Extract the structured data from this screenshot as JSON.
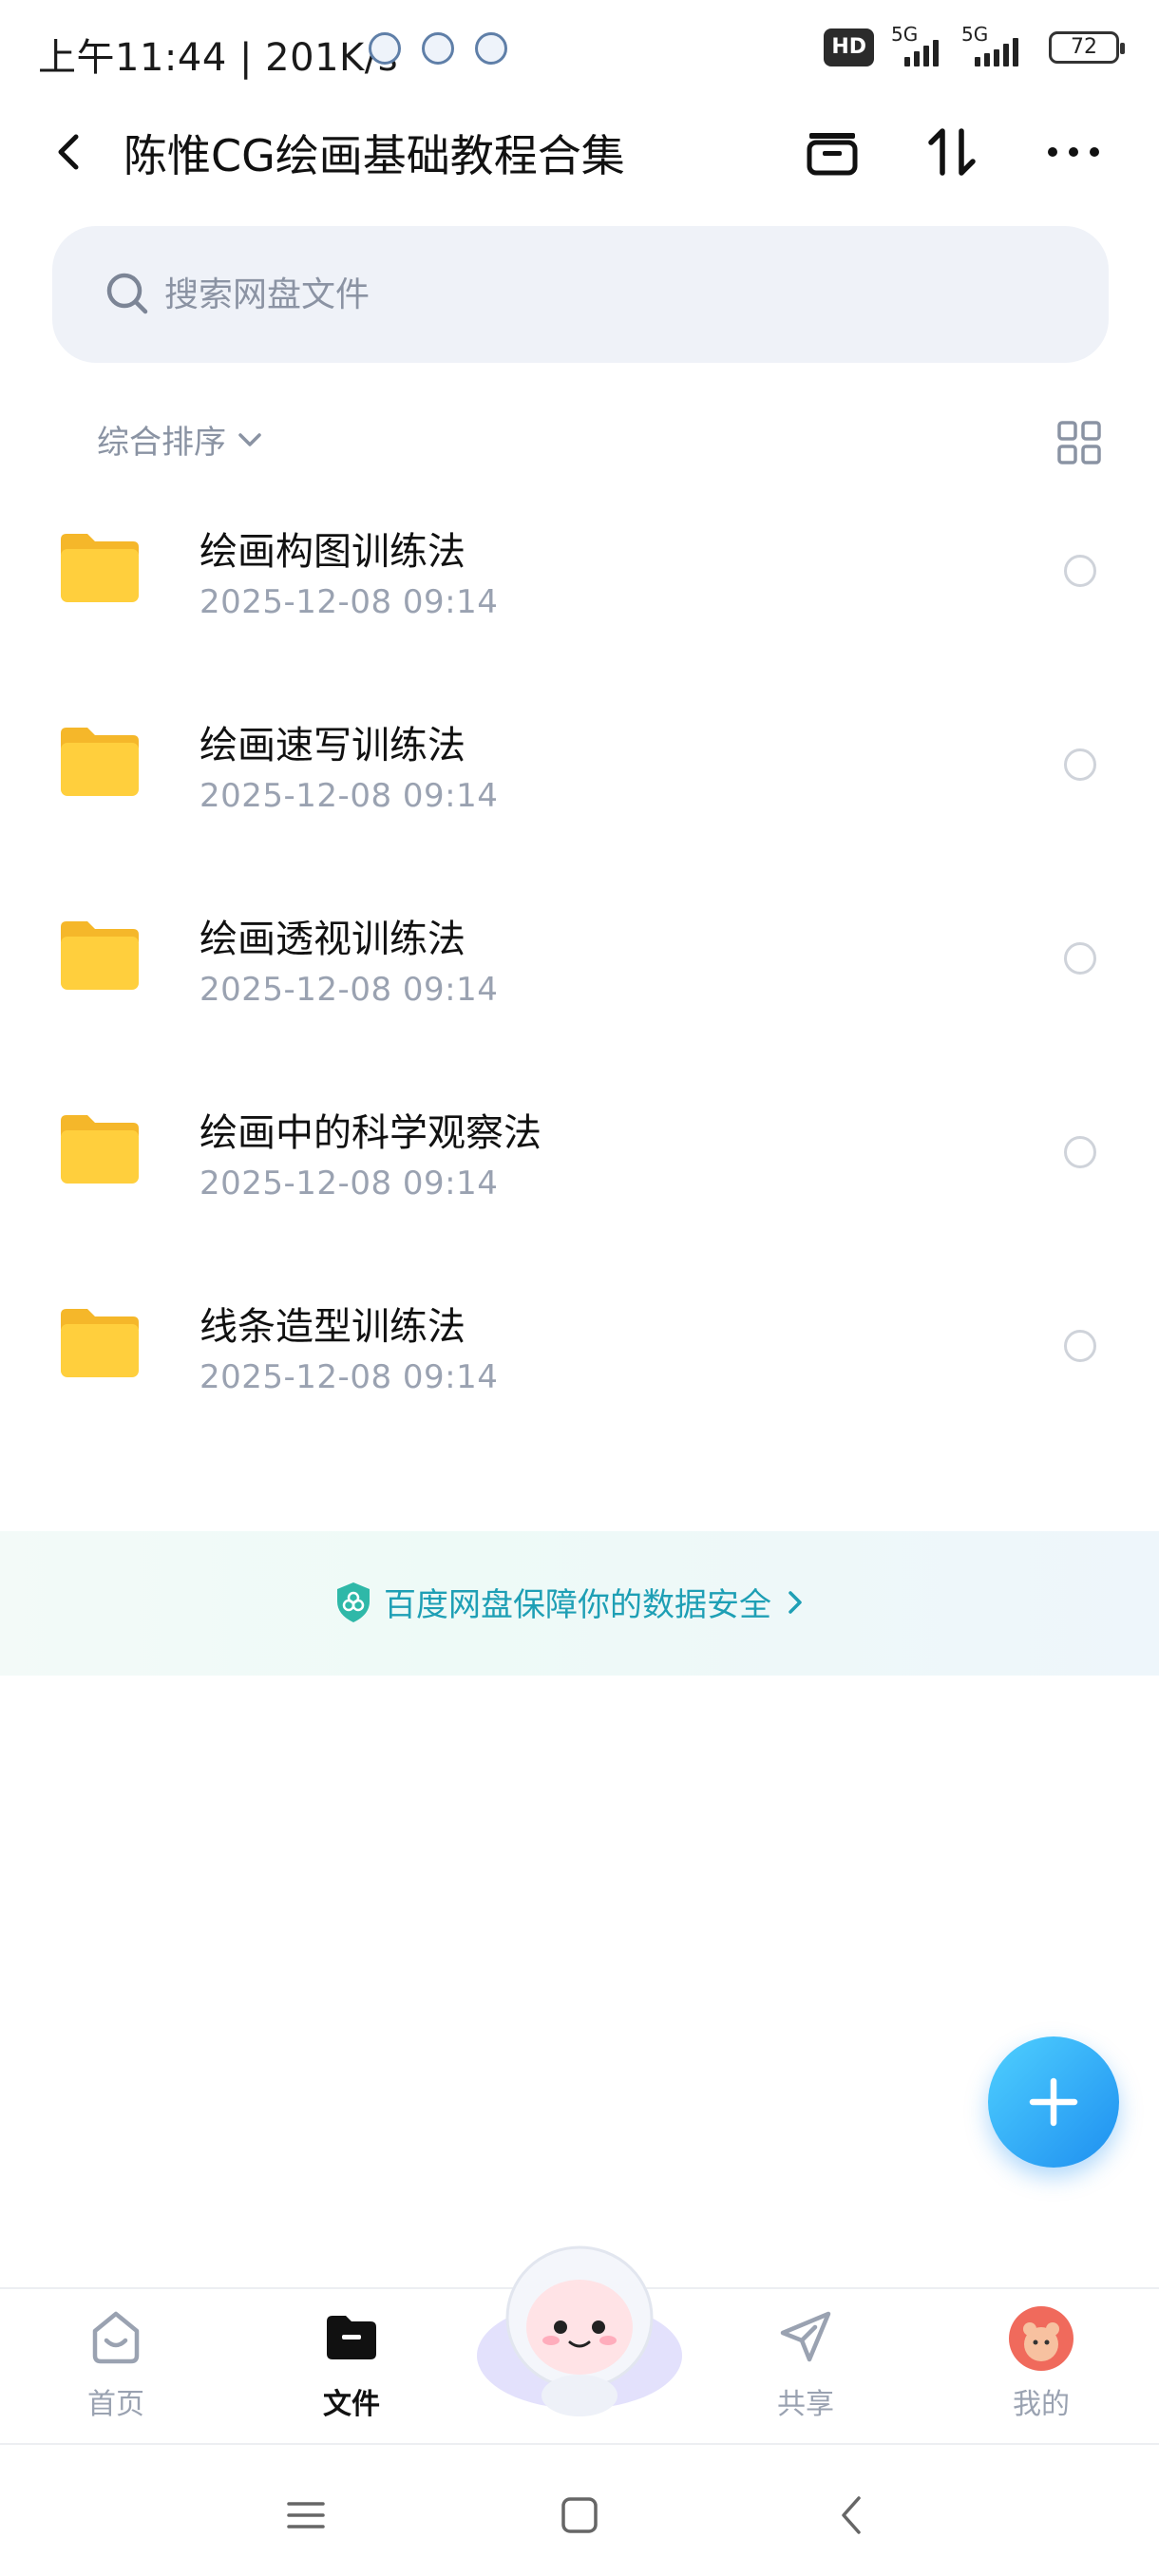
{
  "status_bar": {
    "time": "上午11:44 | 201K/s",
    "network_label_1": "5G",
    "network_label_2": "5G",
    "hd_label": "HD",
    "battery": "72"
  },
  "header": {
    "title": "陈惟CG绘画基础教程合集"
  },
  "search": {
    "placeholder": "搜索网盘文件"
  },
  "sort": {
    "label": "综合排序"
  },
  "files": [
    {
      "name": "绘画构图训练法",
      "date": "2025-12-08  09:14"
    },
    {
      "name": "绘画速写训练法",
      "date": "2025-12-08  09:14"
    },
    {
      "name": "绘画透视训练法",
      "date": "2025-12-08  09:14"
    },
    {
      "name": "绘画中的科学观察法",
      "date": "2025-12-08  09:14"
    },
    {
      "name": "线条造型训练法",
      "date": "2025-12-08  09:14"
    }
  ],
  "banner": {
    "text": "百度网盘保障你的数据安全"
  },
  "bottom_nav": [
    {
      "label": "首页",
      "icon": "home-icon"
    },
    {
      "label": "文件",
      "icon": "folder-icon"
    },
    {
      "label": "共享",
      "icon": "share-icon"
    },
    {
      "label": "我的",
      "icon": "avatar"
    }
  ],
  "colors": {
    "accent": "#1e8ff0",
    "folder": "#ffc933",
    "banner_text": "#1e9fb5"
  }
}
